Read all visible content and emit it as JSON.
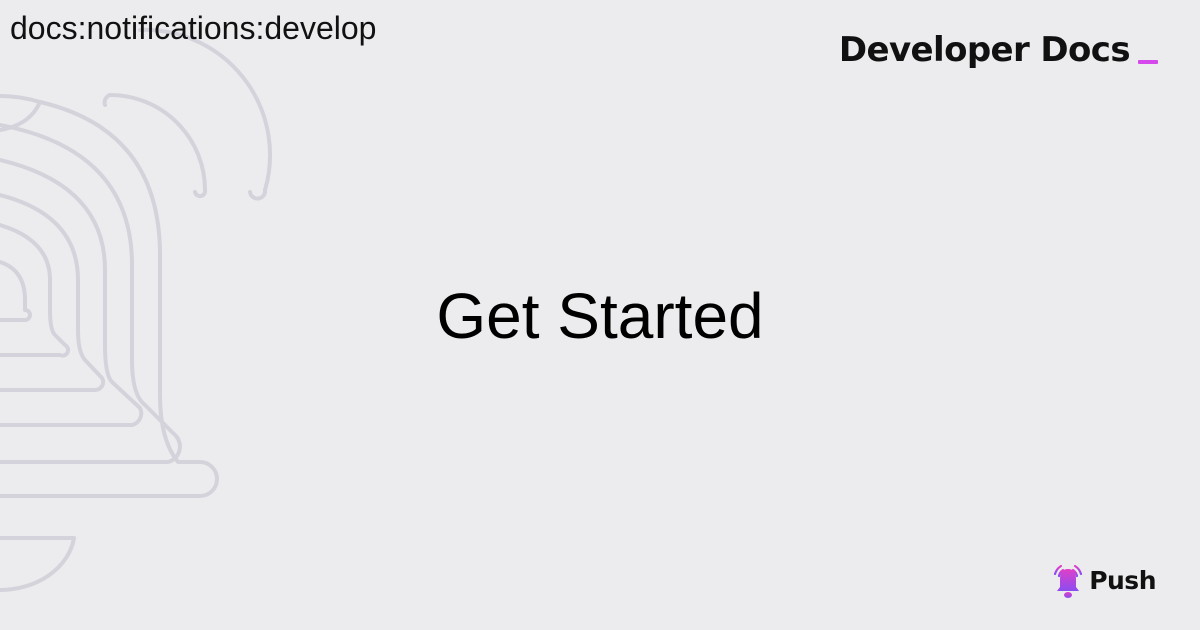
{
  "breadcrumb": "docs:notifications:develop",
  "brand": {
    "title": "Developer Docs",
    "accent_color": "#d548ec"
  },
  "headline": "Get Started",
  "logo": {
    "name": "Push",
    "icon": "bell-icon"
  },
  "colors": {
    "background": "#ececee",
    "outline": "#d4d3db"
  }
}
